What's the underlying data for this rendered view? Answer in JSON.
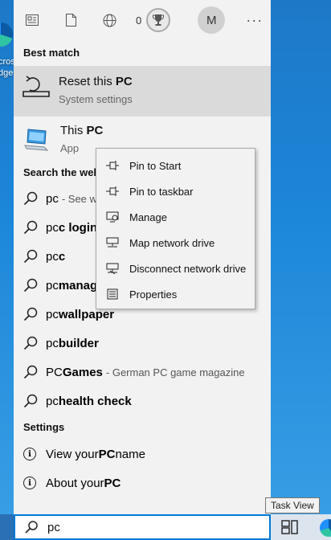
{
  "desktop": {
    "edge_label_lines": [
      "cros",
      "dge"
    ]
  },
  "toolbar": {
    "icons": [
      "news-icon",
      "document-icon",
      "globe-icon"
    ],
    "rewards_count": "0",
    "avatar_initial": "M",
    "more_glyph": "···"
  },
  "best_match": {
    "heading": "Best match",
    "title_prefix": "Reset this ",
    "title_bold": "PC",
    "subtitle": "System settings"
  },
  "app_item": {
    "title_prefix": "This ",
    "title_bold": "PC",
    "subtitle": "App"
  },
  "web": {
    "heading": "Search the web",
    "rows": [
      {
        "prefix": "pc",
        "bold": "",
        "suffix": "- See web results"
      },
      {
        "prefix": "pc",
        "bold": "c login",
        "suffix": ""
      },
      {
        "prefix": "pc",
        "bold": "c",
        "suffix": ""
      },
      {
        "prefix": "pc ",
        "bold": "manager",
        "suffix": ""
      },
      {
        "prefix": "pc ",
        "bold": "wallpaper",
        "suffix": ""
      },
      {
        "prefix": "pc ",
        "bold": "builder",
        "suffix": ""
      },
      {
        "prefix": "PC ",
        "bold": "Games",
        "suffix": "- German PC game magazine"
      },
      {
        "prefix": "pc ",
        "bold": "health check",
        "suffix": ""
      }
    ]
  },
  "settings": {
    "heading": "Settings",
    "rows": [
      {
        "prefix": "View your ",
        "bold": "PC",
        "suffix": " name"
      },
      {
        "prefix": "About your ",
        "bold": "PC",
        "suffix": ""
      }
    ]
  },
  "context_menu": {
    "items": [
      {
        "label": "Pin to Start",
        "icon": "pin-icon"
      },
      {
        "label": "Pin to taskbar",
        "icon": "pin-icon"
      },
      {
        "label": "Manage",
        "icon": "computer-manage-icon"
      },
      {
        "label": "Map network drive",
        "icon": "network-drive-icon"
      },
      {
        "label": "Disconnect network drive",
        "icon": "network-drive-disconnect-icon"
      },
      {
        "label": "Properties",
        "icon": "properties-icon"
      }
    ]
  },
  "taskbar": {
    "search_value": "pc",
    "tooltip": "Task View"
  }
}
